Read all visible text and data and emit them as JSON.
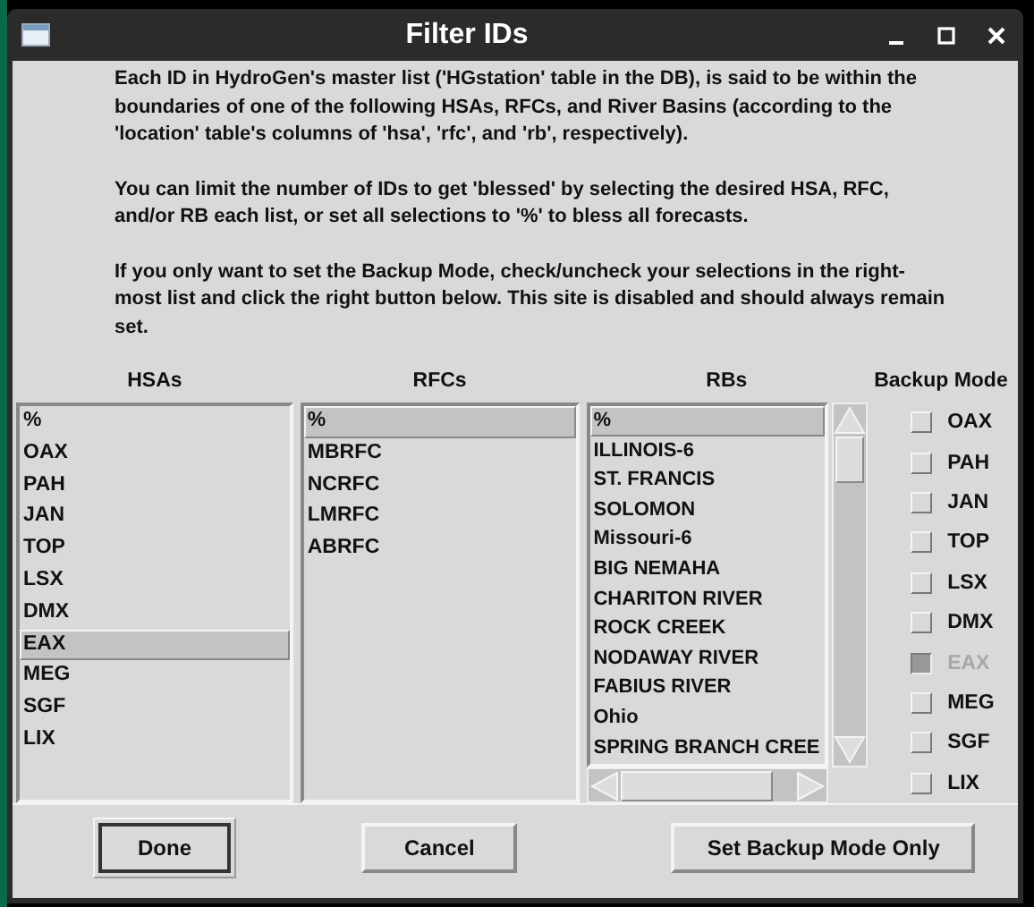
{
  "window": {
    "title": "Filter IDs"
  },
  "instructions": [
    "Each ID in HydroGen's master list ('HGstation' table in the DB), is said to be within the boundaries of one of the following HSAs, RFCs, and River Basins (according to the 'location' table's columns of 'hsa', 'rfc', and 'rb', respectively).",
    "You can limit the number of IDs to get 'blessed' by selecting the desired HSA, RFC, and/or RB each list, or set all selections to '%' to bless all forecasts.",
    "If you only want to set the Backup Mode, check/uncheck your selections in the right-most list and click the right button below.  This site is disabled and should always remain set."
  ],
  "lists": [
    {
      "header": "HSAs",
      "items": [
        {
          "label": "%",
          "selected": false
        },
        {
          "label": "OAX",
          "selected": false
        },
        {
          "label": "PAH",
          "selected": false
        },
        {
          "label": "JAN",
          "selected": false
        },
        {
          "label": "TOP",
          "selected": false
        },
        {
          "label": "LSX",
          "selected": false
        },
        {
          "label": "DMX",
          "selected": false
        },
        {
          "label": "EAX",
          "selected": true
        },
        {
          "label": "MEG",
          "selected": false
        },
        {
          "label": "SGF",
          "selected": false
        },
        {
          "label": "LIX",
          "selected": false
        }
      ]
    },
    {
      "header": "RFCs",
      "items": [
        {
          "label": "%",
          "selected": true
        },
        {
          "label": "MBRFC",
          "selected": false
        },
        {
          "label": "NCRFC",
          "selected": false
        },
        {
          "label": "LMRFC",
          "selected": false
        },
        {
          "label": "ABRFC",
          "selected": false
        }
      ]
    },
    {
      "header": "RBs",
      "scrollable": true,
      "items": [
        {
          "label": "%",
          "selected": true
        },
        {
          "label": "ILLINOIS-6",
          "selected": false
        },
        {
          "label": "ST. FRANCIS",
          "selected": false
        },
        {
          "label": "SOLOMON",
          "selected": false
        },
        {
          "label": "Missouri-6",
          "selected": false
        },
        {
          "label": "BIG NEMAHA",
          "selected": false
        },
        {
          "label": "CHARITON RIVER",
          "selected": false
        },
        {
          "label": "ROCK CREEK",
          "selected": false
        },
        {
          "label": "NODAWAY RIVER",
          "selected": false
        },
        {
          "label": "FABIUS RIVER",
          "selected": false
        },
        {
          "label": "Ohio",
          "selected": false
        },
        {
          "label": "SPRING BRANCH CREE",
          "selected": false
        }
      ]
    }
  ],
  "backup_mode": {
    "header": "Backup Mode",
    "items": [
      {
        "label": "OAX",
        "checked": false,
        "disabled": false
      },
      {
        "label": "PAH",
        "checked": false,
        "disabled": false
      },
      {
        "label": "JAN",
        "checked": false,
        "disabled": false
      },
      {
        "label": "TOP",
        "checked": false,
        "disabled": false
      },
      {
        "label": "LSX",
        "checked": false,
        "disabled": false
      },
      {
        "label": "DMX",
        "checked": false,
        "disabled": false
      },
      {
        "label": "EAX",
        "checked": true,
        "disabled": true
      },
      {
        "label": "MEG",
        "checked": false,
        "disabled": false
      },
      {
        "label": "SGF",
        "checked": false,
        "disabled": false
      },
      {
        "label": "LIX",
        "checked": false,
        "disabled": false
      }
    ]
  },
  "buttons": [
    {
      "label": "Done",
      "default": true
    },
    {
      "label": "Cancel",
      "default": false
    },
    {
      "label": "Set Backup Mode Only",
      "default": false
    }
  ]
}
